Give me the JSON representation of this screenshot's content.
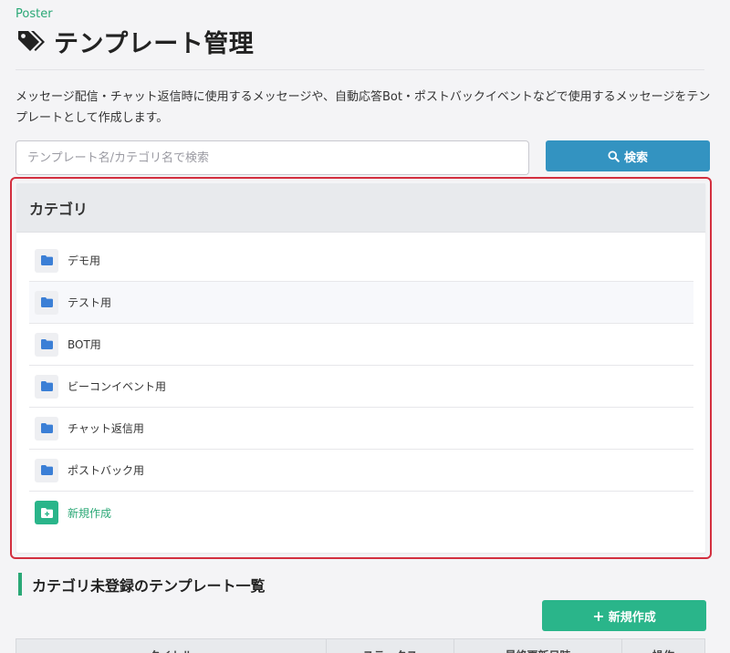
{
  "header": {
    "app_label": "Poster",
    "title": "テンプレート管理",
    "description": "メッセージ配信・チャット返信時に使用するメッセージや、自動応答Bot・ポストバックイベントなどで使用するメッセージをテンプレートとして作成します。"
  },
  "search": {
    "placeholder": "テンプレート名/カテゴリ名で検索",
    "value": "",
    "button_label": "検索"
  },
  "category": {
    "heading": "カテゴリ",
    "items": [
      {
        "label": "デモ用"
      },
      {
        "label": "テスト用"
      },
      {
        "label": "BOT用"
      },
      {
        "label": "ビーコンイベント用"
      },
      {
        "label": "チャット返信用"
      },
      {
        "label": "ポストバック用"
      }
    ],
    "new_label": "新規作成"
  },
  "uncategorized": {
    "title": "カテゴリ未登録のテンプレート一覧",
    "new_button_label": "新規作成",
    "columns": [
      "タイトル",
      "ステータス",
      "最終更新日時",
      "操作"
    ]
  },
  "colors": {
    "accent_green": "#2ab58a",
    "search_blue": "#3393c1",
    "highlight_red": "#d32f3f",
    "folder_blue": "#3b7fd6"
  }
}
